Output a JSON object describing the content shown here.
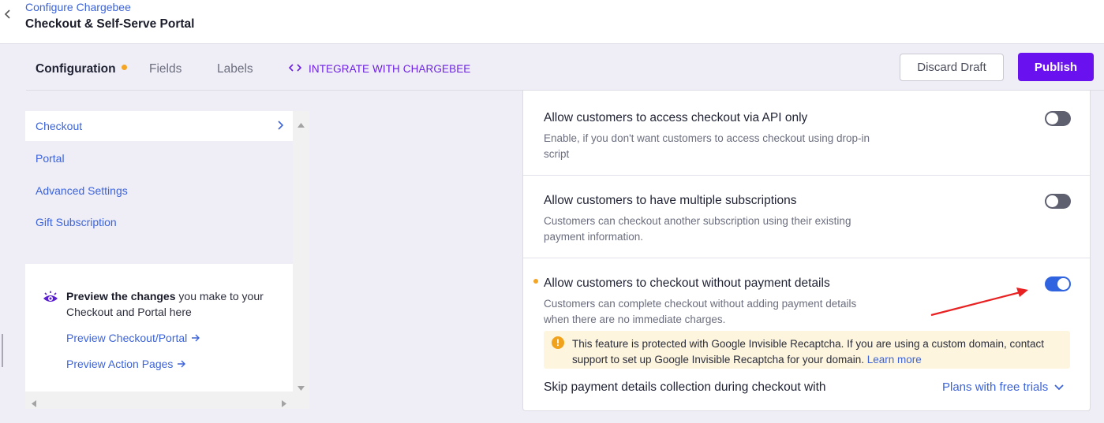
{
  "header": {
    "breadcrumb": "Configure Chargebee",
    "title": "Checkout & Self-Serve Portal"
  },
  "tabs": [
    {
      "label": "Configuration",
      "active": true,
      "modified": true
    },
    {
      "label": "Fields",
      "active": false
    },
    {
      "label": "Labels",
      "active": false
    }
  ],
  "integrate_label": "INTEGRATE WITH CHARGEBEE",
  "actions": {
    "discard_label": "Discard Draft",
    "publish_label": "Publish"
  },
  "sidebar": {
    "items": [
      {
        "label": "Checkout",
        "active": true
      },
      {
        "label": "Portal"
      },
      {
        "label": "Advanced Settings"
      },
      {
        "label": "Gift Subscription"
      }
    ]
  },
  "preview": {
    "bold": "Preview the changes",
    "rest": " you make to your Checkout and Portal here",
    "link_checkout": "Preview Checkout/Portal",
    "link_action": "Preview Action Pages"
  },
  "settings": [
    {
      "title": "Allow customers to access checkout via API only",
      "description": "Enable, if you don't want customers to access checkout using drop-in script",
      "enabled": false
    },
    {
      "title": "Allow customers to have multiple subscriptions",
      "description": "Customers can checkout another subscription using their existing payment information.",
      "enabled": false
    },
    {
      "title": "Allow customers to checkout without payment details",
      "description": "Customers can complete checkout without adding payment details when there are no immediate charges.",
      "enabled": true,
      "modified": true
    }
  ],
  "notice": {
    "text": "This feature is protected with Google Invisible Recaptcha. If you are using a custom domain, contact support to set up Google Invisible Recaptcha for your domain.",
    "link": "Learn more"
  },
  "skip": {
    "label": "Skip payment details collection during checkout with",
    "selected": "Plans with free trials"
  },
  "colors": {
    "accent": "#6a11f0",
    "link": "#3c63d9",
    "toggle_on": "#2f63e0",
    "modified_dot": "#f5a524",
    "annotation_arrow": "#e82222"
  }
}
